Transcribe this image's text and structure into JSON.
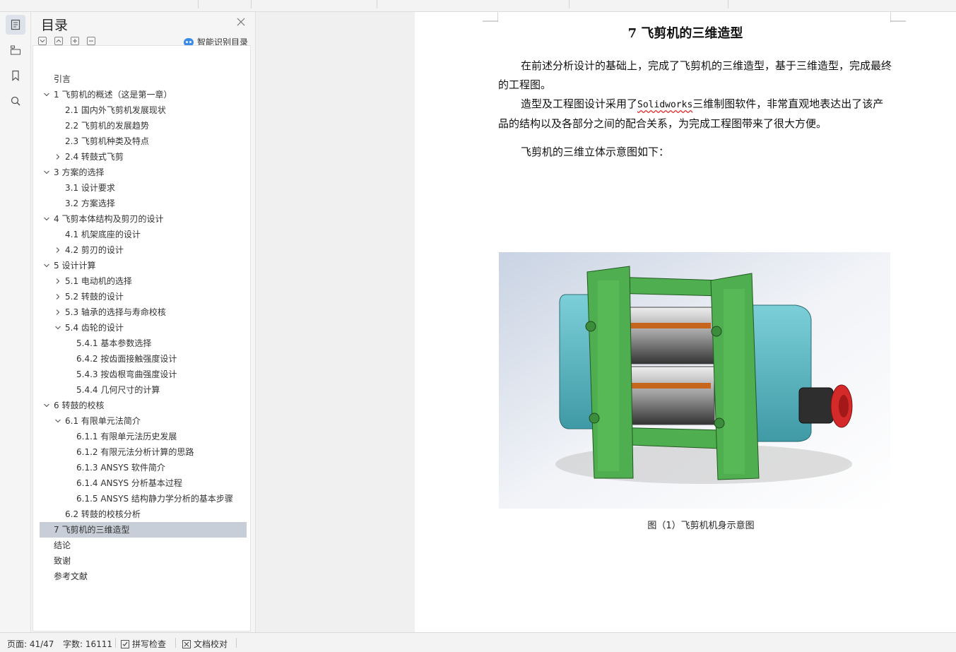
{
  "toc_panel": {
    "title": "目录",
    "smart_toc_label": "智能识别目录",
    "items": [
      {
        "label": "引言",
        "level": 0,
        "chevron": "none"
      },
      {
        "label": "1 飞剪机的概述（这是第一章）",
        "level": 0,
        "chevron": "down"
      },
      {
        "label": "2.1 国内外飞剪机发展现状",
        "level": 1,
        "chevron": "none"
      },
      {
        "label": "2.2 飞剪机的发展趋势",
        "level": 1,
        "chevron": "none"
      },
      {
        "label": "2.3 飞剪机种类及特点",
        "level": 1,
        "chevron": "none"
      },
      {
        "label": "2.4  转鼓式飞剪",
        "level": 1,
        "chevron": "right"
      },
      {
        "label": "3  方案的选择",
        "level": 0,
        "chevron": "down"
      },
      {
        "label": "3.1  设计要求",
        "level": 1,
        "chevron": "none"
      },
      {
        "label": "3.2  方案选择",
        "level": 1,
        "chevron": "none"
      },
      {
        "label": "4 飞剪本体结构及剪刃的设计",
        "level": 0,
        "chevron": "down"
      },
      {
        "label": "4.1 机架底座的设计",
        "level": 1,
        "chevron": "none"
      },
      {
        "label": "4.2 剪刃的设计",
        "level": 1,
        "chevron": "right"
      },
      {
        "label": "5  设计计算",
        "level": 0,
        "chevron": "down"
      },
      {
        "label": "5.1 电动机的选择",
        "level": 1,
        "chevron": "right"
      },
      {
        "label": "5.2  转鼓的设计",
        "level": 1,
        "chevron": "right"
      },
      {
        "label": "5.3 轴承的选择与寿命校核",
        "level": 1,
        "chevron": "right"
      },
      {
        "label": "5.4  齿轮的设计",
        "level": 1,
        "chevron": "down"
      },
      {
        "label": "5.4.1  基本参数选择",
        "level": 2,
        "chevron": "none"
      },
      {
        "label": "6.4.2  按齿面接触强度设计",
        "level": 2,
        "chevron": "none"
      },
      {
        "label": "5.4.3 按齿根弯曲强度设计",
        "level": 2,
        "chevron": "none"
      },
      {
        "label": "5.4.4  几何尺寸的计算",
        "level": 2,
        "chevron": "none"
      },
      {
        "label": "6  转鼓的校核",
        "level": 0,
        "chevron": "down"
      },
      {
        "label": "6.1 有限单元法简介",
        "level": 1,
        "chevron": "down"
      },
      {
        "label": "6.1.1  有限单元法历史发展",
        "level": 2,
        "chevron": "none"
      },
      {
        "label": "6.1.2 有限元法分析计算的思路",
        "level": 2,
        "chevron": "none"
      },
      {
        "label": "6.1.3    ANSYS 软件简介",
        "level": 2,
        "chevron": "none"
      },
      {
        "label": "6.1.4    ANSYS 分析基本过程",
        "level": 2,
        "chevron": "none"
      },
      {
        "label": "6.1.5 ANSYS 结构静力学分析的基本步骤",
        "level": 2,
        "chevron": "none"
      },
      {
        "label": "6.2  转鼓的校核分析",
        "level": 1,
        "chevron": "none"
      },
      {
        "label": "7 飞剪机的三维造型",
        "level": 0,
        "chevron": "none",
        "selected": true
      },
      {
        "label": "结论",
        "level": 0,
        "chevron": "none"
      },
      {
        "label": "致谢",
        "level": 0,
        "chevron": "none"
      },
      {
        "label": "参考文献",
        "level": 0,
        "chevron": "none"
      }
    ]
  },
  "document": {
    "heading": "7 飞剪机的三维造型",
    "para1": "在前述分析设计的基础上，完成了飞剪机的三维造型，基于三维造型，完成最终的工程图。",
    "para2_before": "造型及工程图设计采用了",
    "para2_software": "Solidworks",
    "para2_after": "三维制图软件，非常直观地表达出了该产品的结构以及各部分之间的配合关系，为完成工程图带来了很大方便。",
    "para3": "飞剪机的三维立体示意图如下：",
    "figure_caption": "图（1）飞剪机机身示意图"
  },
  "status_bar": {
    "page": "页面: 41/47",
    "words": "字数: 16111",
    "spell_check": "拼写检查",
    "doc_proof": "文档校对"
  },
  "colors": {
    "selection": "#c8ced7",
    "frame_green": "#4fae4f",
    "housing_teal": "#5ab8c4",
    "flange_red": "#d42a2a"
  }
}
